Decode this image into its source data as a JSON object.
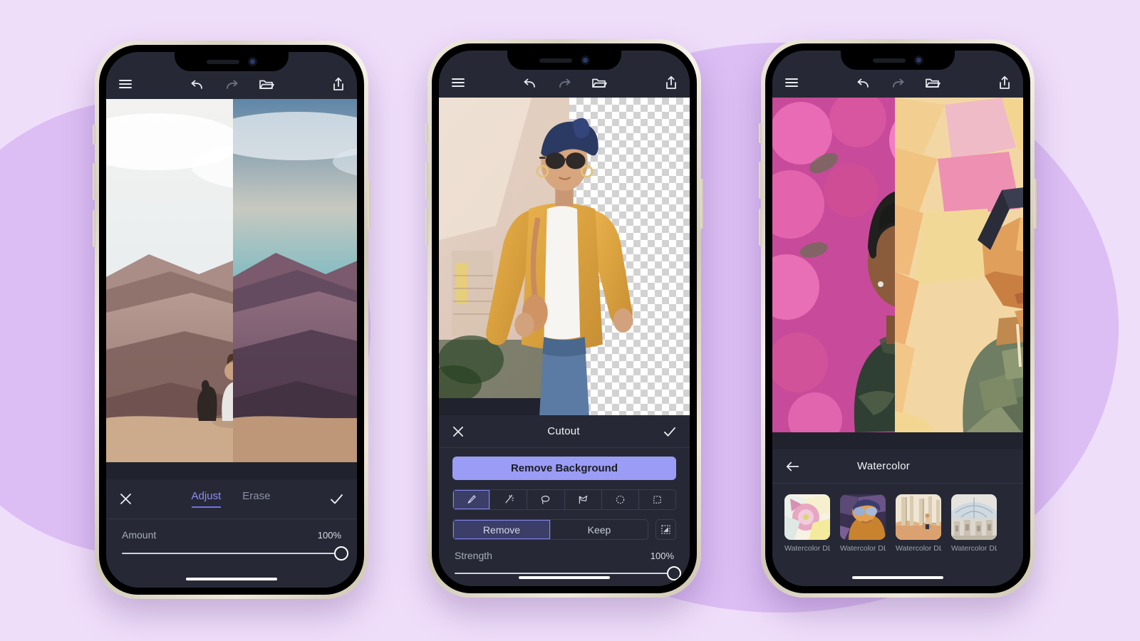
{
  "theme": {
    "background": "#efdefa",
    "blob": "#d6b3f2",
    "panel_bg": "#262935",
    "accent": "#9a9cf5",
    "accent_border": "#8486ef",
    "tab_active": "#8b8df0"
  },
  "toolbar": {
    "menu_icon": "hamburger-menu-icon",
    "undo_icon": "undo-icon",
    "redo_icon": "redo-icon",
    "layers_icon": "layers-folder-icon",
    "share_icon": "share-icon"
  },
  "phones": [
    {
      "id": "phone-adjust",
      "panel": {
        "close_label": "✕",
        "confirm_label": "✓",
        "tabs": [
          {
            "label": "Adjust",
            "active": true
          },
          {
            "label": "Erase",
            "active": false
          }
        ],
        "slider": {
          "label": "Amount",
          "value": "100%",
          "percent": 100
        }
      },
      "canvas": {
        "before_alt": "canyon-landscape-original",
        "after_alt": "canyon-landscape-edited"
      }
    },
    {
      "id": "phone-cutout",
      "panel": {
        "close_label": "✕",
        "title": "Cutout",
        "confirm_label": "✓",
        "primary_button": "Remove Background",
        "tools": [
          {
            "name": "brush-tool-icon",
            "selected": true
          },
          {
            "name": "magic-wand-tool-icon",
            "selected": false
          },
          {
            "name": "lasso-tool-icon",
            "selected": false
          },
          {
            "name": "polygon-lasso-tool-icon",
            "selected": false
          },
          {
            "name": "ellipse-select-tool-icon",
            "selected": false
          },
          {
            "name": "rectangle-select-tool-icon",
            "selected": false
          }
        ],
        "mode": [
          {
            "label": "Remove",
            "selected": true
          },
          {
            "label": "Keep",
            "selected": false
          }
        ],
        "invert_icon": "invert-selection-icon",
        "slider": {
          "label": "Strength",
          "value": "100%",
          "percent": 100
        }
      },
      "canvas": {
        "subject_alt": "woman-in-yellow-coat-cutout",
        "transparent_label": "transparent-checkerboard"
      }
    },
    {
      "id": "phone-watercolor",
      "panel": {
        "back_icon": "back-arrow-icon",
        "title": "Watercolor",
        "presets": [
          {
            "label": "Watercolor DL...",
            "thumb": "watercolor-flower-thumb"
          },
          {
            "label": "Watercolor DL...",
            "thumb": "watercolor-portrait-thumb"
          },
          {
            "label": "Watercolor DL...",
            "thumb": "watercolor-beach-thumb"
          },
          {
            "label": "Watercolor DL...",
            "thumb": "watercolor-architecture-thumb"
          }
        ]
      },
      "canvas": {
        "before_alt": "man-with-pink-flowers-original",
        "after_alt": "man-with-pink-flowers-watercolor"
      }
    }
  ]
}
